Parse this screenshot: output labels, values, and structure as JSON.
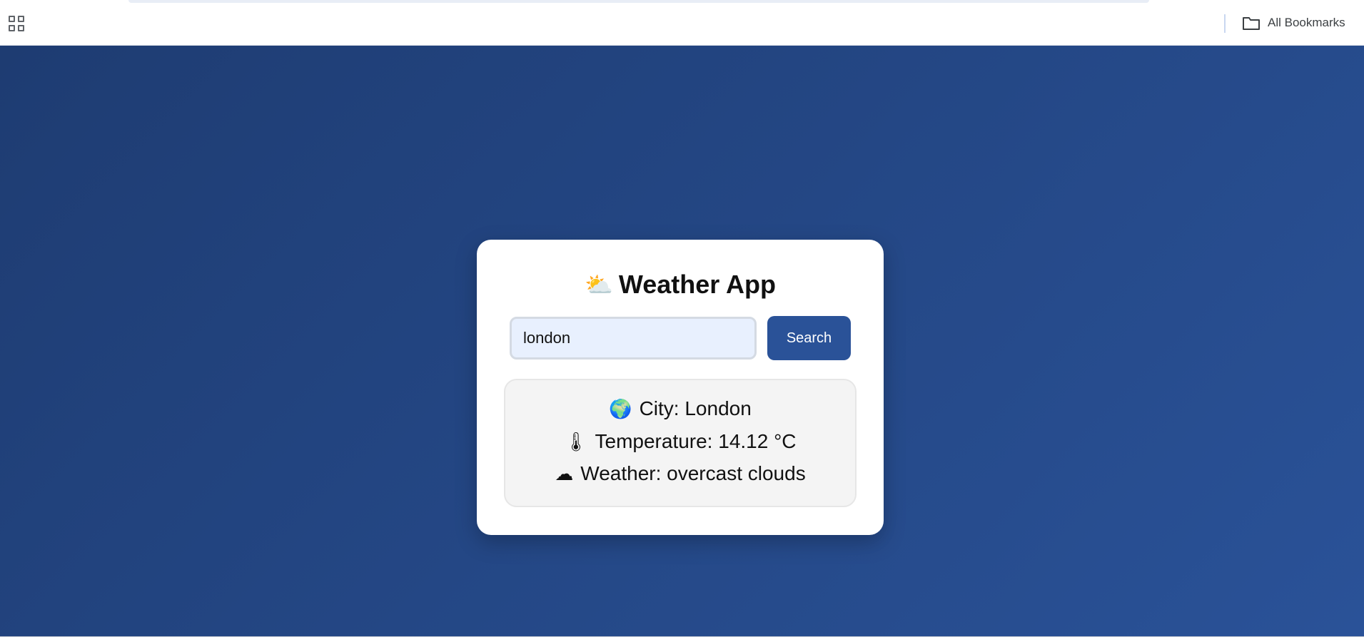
{
  "browser": {
    "bookmarks_bar": {
      "apps_icon": "apps-grid-icon",
      "all_bookmarks_label": "All Bookmarks",
      "folder_icon": "folder-icon"
    }
  },
  "app": {
    "title_icon": "⛅",
    "title": "Weather App",
    "search": {
      "value": "london",
      "button_label": "Search"
    },
    "results": {
      "city": {
        "icon": "🌍",
        "text": "City: London"
      },
      "temperature": {
        "icon": "🌡",
        "text": "Temperature: 14.12 °C"
      },
      "weather": {
        "icon": "☁",
        "text": "Weather: overcast clouds"
      }
    }
  },
  "colors": {
    "background_start": "#1e3c72",
    "background_end": "#2a5298",
    "button": "#2a5298",
    "input_bg": "#e8f0fe",
    "result_bg": "#f4f4f4"
  }
}
